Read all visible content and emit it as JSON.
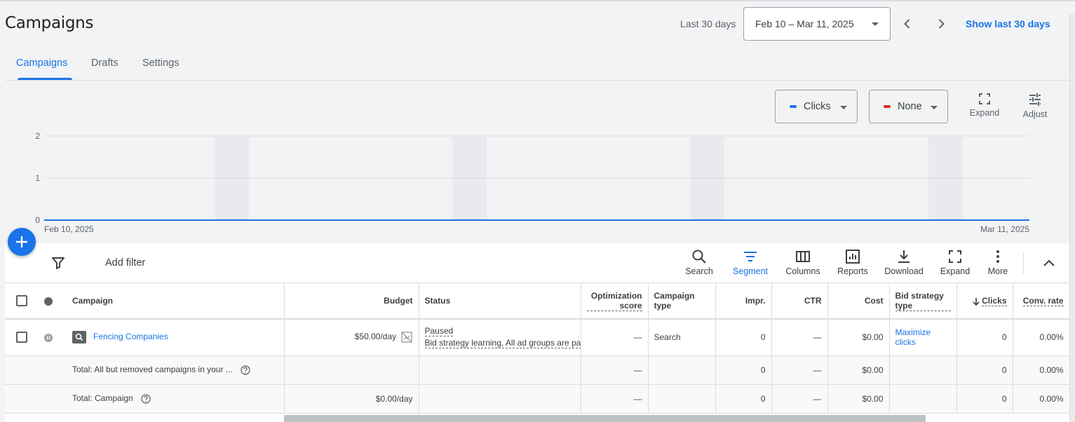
{
  "header": {
    "title": "Campaigns",
    "date_label": "Last 30 days",
    "date_range": "Feb 10 – Mar 11, 2025",
    "show_last": "Show last 30 days"
  },
  "tabs": [
    {
      "label": "Campaigns",
      "active": true
    },
    {
      "label": "Drafts",
      "active": false
    },
    {
      "label": "Settings",
      "active": false
    }
  ],
  "chart_controls": {
    "metric1": {
      "label": "Clicks",
      "color": "#1a73e8"
    },
    "metric2": {
      "label": "None",
      "color": "#d93025"
    },
    "expand_label": "Expand",
    "adjust_label": "Adjust"
  },
  "chart_data": {
    "type": "line",
    "x_start_label": "Feb 10, 2025",
    "x_end_label": "Mar 11, 2025",
    "y_ticks": [
      "0",
      "1",
      "2"
    ],
    "ylim": [
      0,
      2
    ],
    "series": [
      {
        "values": [
          0,
          0,
          0,
          0,
          0,
          0,
          0,
          0,
          0,
          0,
          0,
          0,
          0,
          0,
          0,
          0,
          0,
          0,
          0,
          0,
          0,
          0,
          0,
          0,
          0,
          0,
          0,
          0,
          0,
          0
        ],
        "color": "#1a73e8"
      }
    ],
    "grid": true
  },
  "toolbar": {
    "add_filter": "Add filter",
    "tools": [
      {
        "label": "Search",
        "icon": "search-icon"
      },
      {
        "label": "Segment",
        "icon": "segment-icon"
      },
      {
        "label": "Columns",
        "icon": "columns-icon"
      },
      {
        "label": "Reports",
        "icon": "reports-icon"
      },
      {
        "label": "Download",
        "icon": "download-icon"
      },
      {
        "label": "Expand",
        "icon": "fullscreen-icon"
      },
      {
        "label": "More",
        "icon": "more-vert-icon"
      }
    ]
  },
  "table": {
    "headers": {
      "campaign": "Campaign",
      "budget": "Budget",
      "status": "Status",
      "optimization_score": "Optimization score",
      "campaign_type": "Campaign type",
      "impr": "Impr.",
      "ctr": "CTR",
      "cost": "Cost",
      "bid_strategy_type": "Bid strategy type",
      "clicks": "Clicks",
      "conv_rate": "Conv. rate"
    },
    "rows": [
      {
        "campaign": "Fencing Companies",
        "budget": "$50.00/day",
        "status_line1": "Paused",
        "status_line2": "Bid strategy learning, All ad groups are paused",
        "optimization_score": "—",
        "campaign_type": "Search",
        "impr": "0",
        "ctr": "—",
        "cost": "$0.00",
        "bid_strategy": "Maximize clicks",
        "clicks": "0",
        "conv_rate": "0.00%"
      }
    ],
    "totals": [
      {
        "label": "Total: All but removed campaigns in your ...",
        "budget": "",
        "optimization_score": "—",
        "impr": "0",
        "ctr": "—",
        "cost": "$0.00",
        "clicks": "0",
        "conv_rate": "0.00%"
      },
      {
        "label": "Total: Campaign",
        "budget": "$0.00/day",
        "optimization_score": "—",
        "impr": "0",
        "ctr": "—",
        "cost": "$0.00",
        "clicks": "0",
        "conv_rate": "0.00%"
      }
    ]
  }
}
